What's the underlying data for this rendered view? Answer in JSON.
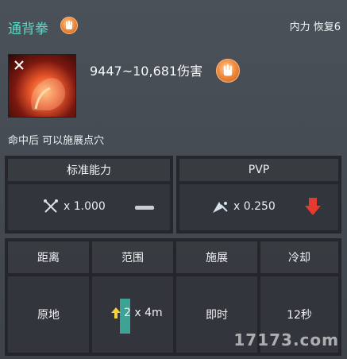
{
  "skill": {
    "name": "通背拳",
    "meta": "内力 恢复6",
    "damage": "9447~10,681伤害",
    "description": "命中后 可以施展点穴"
  },
  "stats": {
    "standard": {
      "header": "标准能力",
      "multiplier": "x 1.000"
    },
    "pvp": {
      "header": "PVP",
      "multiplier": "x 0.250"
    }
  },
  "attributes": {
    "headers": [
      "距离",
      "范围",
      "施展",
      "冷却"
    ],
    "values": [
      "原地",
      "2 x 4m",
      "即时",
      "12秒"
    ]
  },
  "watermark": "17173.com",
  "colors": {
    "title": "#5fd6c7",
    "badge": "#f08a3c",
    "down_arrow": "#e63a2e",
    "up_arrow": "#f2d23a",
    "range_marker": "#3fb7a6"
  },
  "icons": {
    "title_badge": "fist-icon",
    "damage_badge": "fist-icon",
    "standard": "crossed-swords-icon",
    "pvp": "pvp-arrow-icon",
    "standard_indicator": "dash-icon",
    "pvp_indicator": "down-arrow-icon",
    "range": "up-arrow-icon"
  }
}
